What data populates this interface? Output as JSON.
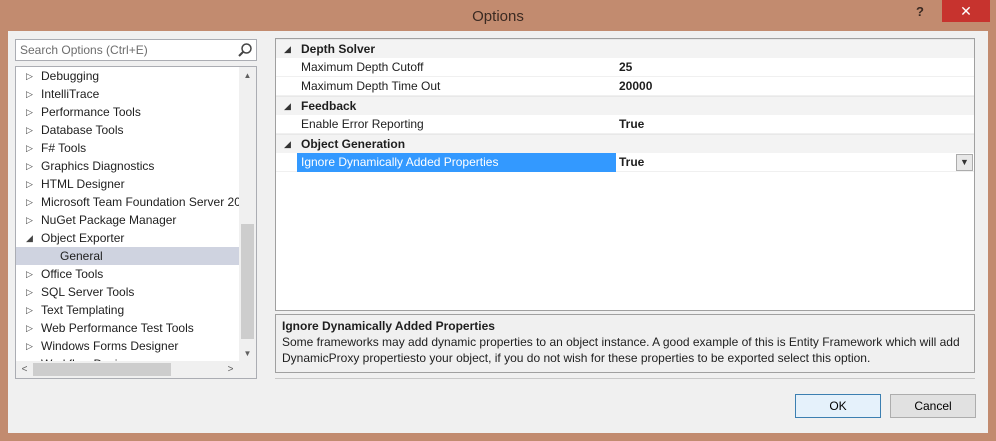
{
  "window": {
    "title": "Options",
    "help_label": "?",
    "close_label": "✕"
  },
  "search": {
    "placeholder": "Search Options (Ctrl+E)",
    "icon": "search-icon"
  },
  "tree": {
    "items": [
      {
        "label": "Debugging",
        "expanded": false
      },
      {
        "label": "IntelliTrace",
        "expanded": false
      },
      {
        "label": "Performance Tools",
        "expanded": false
      },
      {
        "label": "Database Tools",
        "expanded": false
      },
      {
        "label": "F# Tools",
        "expanded": false
      },
      {
        "label": "Graphics Diagnostics",
        "expanded": false
      },
      {
        "label": "HTML Designer",
        "expanded": false
      },
      {
        "label": "Microsoft Team Foundation Server 20",
        "expanded": false
      },
      {
        "label": "NuGet Package Manager",
        "expanded": false
      },
      {
        "label": "Object Exporter",
        "expanded": true
      },
      {
        "label": "General",
        "child": true,
        "selected": true
      },
      {
        "label": "Office Tools",
        "expanded": false
      },
      {
        "label": "SQL Server Tools",
        "expanded": false
      },
      {
        "label": "Text Templating",
        "expanded": false
      },
      {
        "label": "Web Performance Test Tools",
        "expanded": false
      },
      {
        "label": "Windows Forms Designer",
        "expanded": false
      },
      {
        "label": "Workflow Designer",
        "expanded": false
      }
    ]
  },
  "grid": {
    "categories": [
      {
        "label": "Depth Solver",
        "properties": [
          {
            "name": "Maximum Depth Cutoff",
            "value": "25"
          },
          {
            "name": "Maximum Depth Time Out",
            "value": "20000"
          }
        ]
      },
      {
        "label": "Feedback",
        "properties": [
          {
            "name": "Enable Error Reporting",
            "value": "True"
          }
        ]
      },
      {
        "label": "Object Generation",
        "properties": [
          {
            "name": "Ignore Dynamically Added Properties",
            "value": "True",
            "selected": true
          }
        ]
      }
    ]
  },
  "description": {
    "title": "Ignore Dynamically Added Properties",
    "text": "Some frameworks may add dynamic properties to an object instance. A good example of this is Entity Framework which will add DynamicProxy propertiesto your object, if you do not wish for these properties to be exported select this option."
  },
  "buttons": {
    "ok": "OK",
    "cancel": "Cancel"
  },
  "colors": {
    "frame": "#c28b6f",
    "selection": "#3399ff",
    "close": "#c7332e"
  }
}
